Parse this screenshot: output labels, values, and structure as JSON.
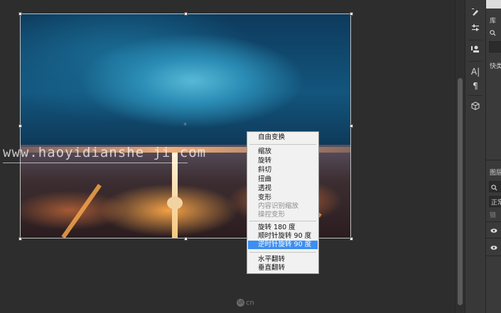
{
  "watermark": "www.haoyidianshe ji.com",
  "bottom_logo": {
    "icon": "ui-logo-icon",
    "text": "cn"
  },
  "context_menu": {
    "items": [
      {
        "label": "自由变换",
        "state": "normal"
      },
      {
        "label": "缩放",
        "state": "normal"
      },
      {
        "label": "旋转",
        "state": "normal"
      },
      {
        "label": "斜切",
        "state": "normal"
      },
      {
        "label": "扭曲",
        "state": "normal"
      },
      {
        "label": "透视",
        "state": "normal"
      },
      {
        "label": "变形",
        "state": "normal"
      },
      {
        "label": "内容识别缩放",
        "state": "disabled"
      },
      {
        "label": "操控变形",
        "state": "disabled"
      },
      {
        "label": "旋转 180 度",
        "state": "normal"
      },
      {
        "label": "顺时针旋转 90 度",
        "state": "normal"
      },
      {
        "label": "逆时针旋转 90 度",
        "state": "highlighted"
      },
      {
        "label": "水平翻转",
        "state": "normal"
      },
      {
        "label": "垂直翻转",
        "state": "normal"
      }
    ]
  },
  "tool_strip": {
    "icons": [
      "brush-settings-icon",
      "adjust-sliders-icon",
      "clone-source-icon",
      "character-icon",
      "paragraph-icon",
      "3d-cube-icon"
    ],
    "char_glyph": "A|",
    "para_glyph": "¶"
  },
  "right_panel": {
    "library_label": "库",
    "search_icon": "search-icon",
    "quick_label": "快类",
    "layers_label": "图层",
    "filter_icon": "filter-search-icon",
    "blend_mode": "正常",
    "lock_label": "锁",
    "eye_icon": "visibility-eye-icon"
  }
}
